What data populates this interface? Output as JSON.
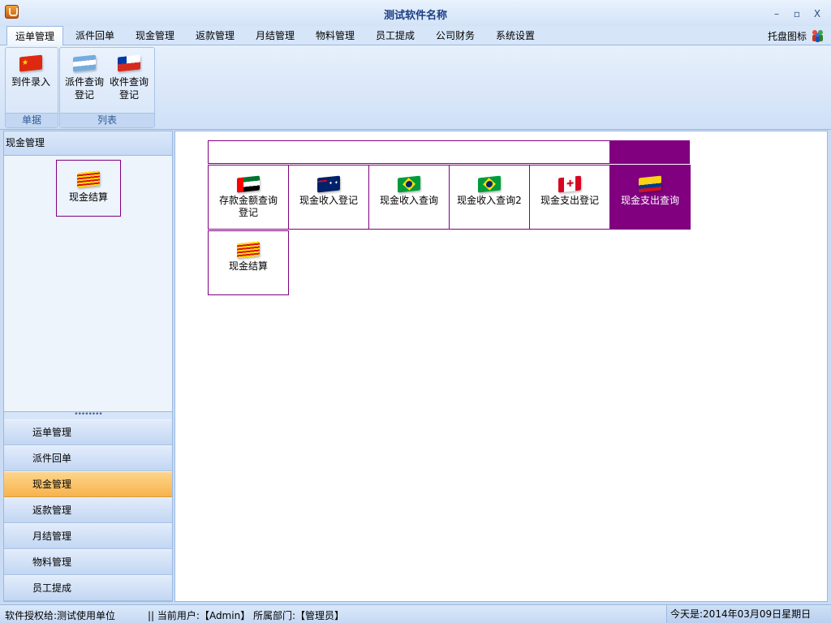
{
  "window": {
    "title": "测试软件名称",
    "minimize": "–",
    "maximize": "▫",
    "close": "X"
  },
  "menu": {
    "tabs": [
      {
        "label": "运单管理"
      },
      {
        "label": "派件回单"
      },
      {
        "label": "现金管理"
      },
      {
        "label": "返款管理"
      },
      {
        "label": "月结管理"
      },
      {
        "label": "物料管理"
      },
      {
        "label": "员工提成"
      },
      {
        "label": "公司财务"
      },
      {
        "label": "系统设置"
      }
    ],
    "active_index": 0,
    "tray_label": "托盘图标"
  },
  "ribbon": {
    "groups": [
      {
        "label": "单据",
        "buttons": [
          {
            "label": "到件录入",
            "icon": "china-flag-icon"
          }
        ]
      },
      {
        "label": "列表",
        "buttons": [
          {
            "label": "派件查询登记",
            "icon": "argentina-flag-icon"
          },
          {
            "label": "收件查询登记",
            "icon": "chile-flag-icon"
          }
        ]
      }
    ]
  },
  "left_panel": {
    "header": "现金管理",
    "items": [
      {
        "label": "现金结算",
        "icon": "catalonia-flag-icon"
      }
    ],
    "splitter": "••••••••",
    "nav": [
      {
        "label": "运单管理"
      },
      {
        "label": "派件回单"
      },
      {
        "label": "现金管理"
      },
      {
        "label": "返款管理"
      },
      {
        "label": "月结管理"
      },
      {
        "label": "物料管理"
      },
      {
        "label": "员工提成"
      }
    ],
    "active_nav_index": 2
  },
  "main": {
    "search": {
      "value": "",
      "placeholder": ""
    },
    "tiles": [
      {
        "label": "存款金额查询登记",
        "icon": "uae-flag-icon"
      },
      {
        "label": "现金收入登记",
        "icon": "australia-flag-icon"
      },
      {
        "label": "现金收入查询",
        "icon": "brazil-flag-icon"
      },
      {
        "label": "现金收入查询2",
        "icon": "brazil-flag-icon"
      },
      {
        "label": "现金支出登记",
        "icon": "canada-flag-icon"
      },
      {
        "label": "现金支出查询",
        "icon": "colombia-flag-icon"
      },
      {
        "label": "现金结算",
        "icon": "catalonia-flag-icon"
      }
    ],
    "active_tile_index": 5
  },
  "status": {
    "left": "软件授权给:测试使用单位",
    "user": "|| 当前用户:【Admin】  所属部门:【管理员】",
    "date": "今天是:2014年03月09日星期日"
  },
  "colors": {
    "accent": "#800080",
    "active_nav": "#f7b34d",
    "title_text": "#1c3f85"
  }
}
